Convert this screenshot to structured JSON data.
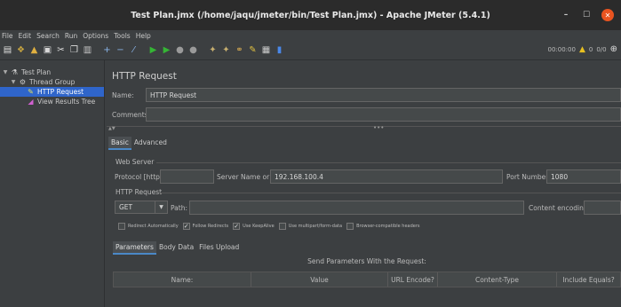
{
  "window": {
    "title": "Test Plan.jmx (/home/jaqu/jmeter/bin/Test Plan.jmx) - Apache JMeter (5.4.1)"
  },
  "menu": [
    "File",
    "Edit",
    "Search",
    "Run",
    "Options",
    "Tools",
    "Help"
  ],
  "toolbar": {
    "timer": "00:00:00",
    "warnings": "0",
    "threads": "0/0"
  },
  "tree": [
    {
      "label": "Test Plan",
      "level": 0,
      "icon": "test-plan-icon",
      "expanded": true
    },
    {
      "label": "Thread Group",
      "level": 1,
      "icon": "thread-group-icon",
      "expanded": true
    },
    {
      "label": "HTTP Request",
      "level": 2,
      "icon": "http-request-icon",
      "selected": true
    },
    {
      "label": "View Results Tree",
      "level": 2,
      "icon": "results-tree-icon"
    }
  ],
  "panel": {
    "title": "HTTP Request",
    "name_label": "Name:",
    "name_value": "HTTP Request",
    "comments_label": "Comments:",
    "comments_value": ""
  },
  "config_tabs": [
    "Basic",
    "Advanced"
  ],
  "web_server": {
    "legend": "Web Server",
    "protocol_label": "Protocol [http]:",
    "protocol_value": "",
    "server_label": "Server Name or IP:",
    "server_value": "192.168.100.4",
    "port_label": "Port Number:",
    "port_value": "1080"
  },
  "http_request": {
    "legend": "HTTP Request",
    "method": "GET",
    "path_label": "Path:",
    "path_value": "",
    "encoding_label": "Content encoding:",
    "encoding_value": ""
  },
  "checkboxes": [
    {
      "label": "Redirect Automatically",
      "checked": false
    },
    {
      "label": "Follow Redirects",
      "checked": true
    },
    {
      "label": "Use KeepAlive",
      "checked": true
    },
    {
      "label": "Use multipart/form-data",
      "checked": false
    },
    {
      "label": "Browser-compatible headers",
      "checked": false
    }
  ],
  "param_tabs": [
    "Parameters",
    "Body Data",
    "Files Upload"
  ],
  "params": {
    "caption": "Send Parameters With the Request:",
    "columns": [
      "Name:",
      "Value",
      "URL Encode?",
      "Content-Type",
      "Include Equals?"
    ]
  }
}
